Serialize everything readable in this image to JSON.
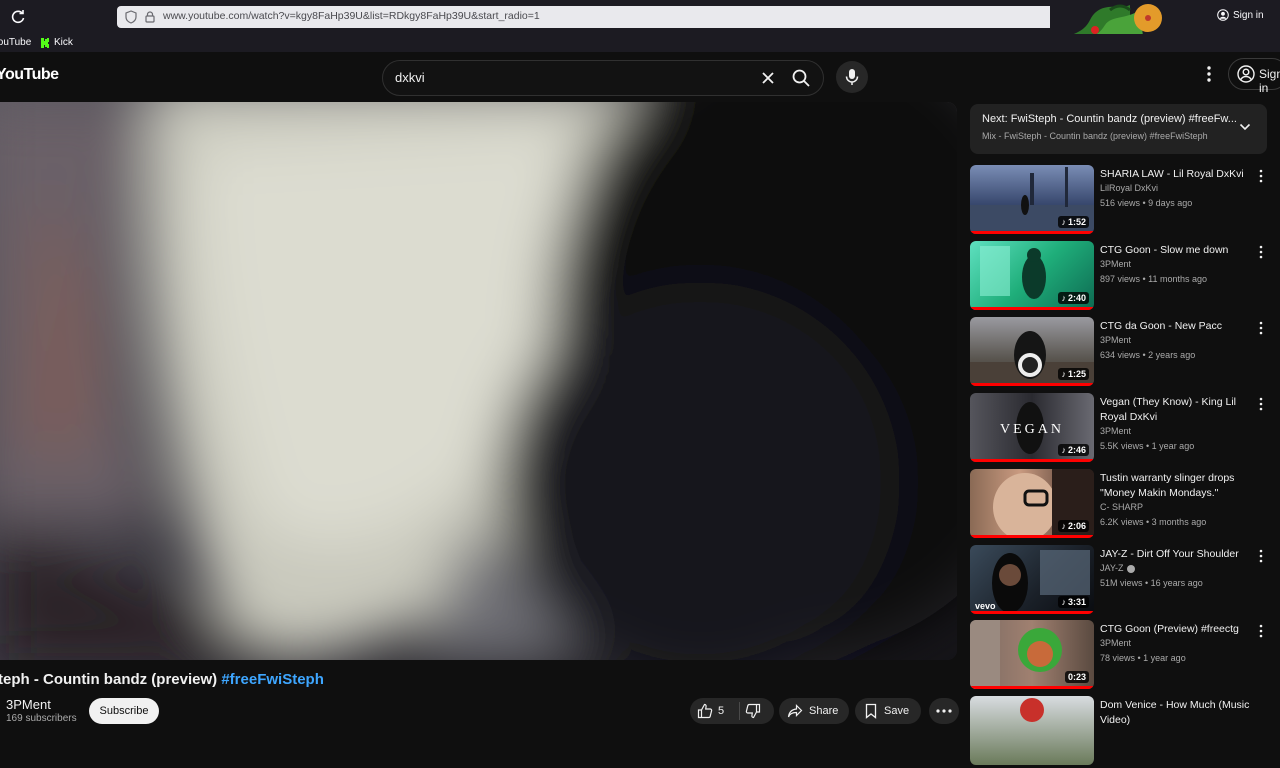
{
  "browser": {
    "url": "www.youtube.com/watch?v=kgy8FaHp39U&list=RDkgy8FaHp39U&start_radio=1",
    "signin": "Sign in",
    "bookmarks": [
      {
        "label": "YouTube",
        "icon": "youtube-icon"
      },
      {
        "label": "Kick",
        "icon": "kick-icon"
      }
    ]
  },
  "header": {
    "logo": "YouTube",
    "search_value": "dxkvi",
    "signin": "Sign in"
  },
  "video": {
    "title_main": "FwiSteph - Countin bandz (preview)",
    "title_tag": "#freeFwiSteph",
    "channel": "3PMent",
    "subscribers": "169 subscribers",
    "subscribe_label": "Subscribe",
    "likes": "5",
    "share_label": "Share",
    "save_label": "Save"
  },
  "sidebar": {
    "next_title": "Next: FwiSteph - Countin bandz (preview) #freeFw...",
    "next_sub": "Mix - FwiSteph - Countin bandz (preview) #freeFwiSteph",
    "recs": [
      {
        "title": "SHARIA LAW - Lil Royal DxKvi",
        "channel": "LilRoyal DxKvi",
        "meta": "516 views • 9 days ago",
        "duration": "1:52",
        "thumb": "#2a3a55"
      },
      {
        "title": "CTG Goon - Slow me down",
        "channel": "3PMent",
        "meta": "897 views • 11 months ago",
        "duration": "2:40",
        "thumb": "#1fae7a"
      },
      {
        "title": "CTG da Goon - New Pacc",
        "channel": "3PMent",
        "meta": "634 views • 2 years ago",
        "duration": "1:25",
        "thumb": "#55504a"
      },
      {
        "title": "Vegan (They Know) - King Lil Royal DxKvi",
        "channel": "3PMent",
        "meta": "5.5K views • 1 year ago",
        "duration": "2:46",
        "thumb": "#3a3a40",
        "overlay": "VEGAN"
      },
      {
        "title": "Tustin warranty slinger drops \"Money Makin Mondays.\"",
        "channel": "C- SHARP",
        "meta": "6.2K views • 3 months ago",
        "duration": "2:06",
        "thumb": "#6a4a3e"
      },
      {
        "title": "JAY-Z - Dirt Off Your Shoulder",
        "channel": "JAY-Z",
        "meta": "51M views • 16 years ago",
        "duration": "3:31",
        "thumb": "#2e3540",
        "overlay": "vevo"
      },
      {
        "title": "CTG Goon (Preview) #freectg",
        "channel": "3PMent",
        "meta": "78 views • 1 year ago",
        "duration": "0:23",
        "thumb": "#6a5a50"
      },
      {
        "title": "Dom Venice - How Much (Music Video)",
        "channel": "",
        "meta": "",
        "duration": "",
        "thumb": "#4a5a3a"
      }
    ]
  }
}
